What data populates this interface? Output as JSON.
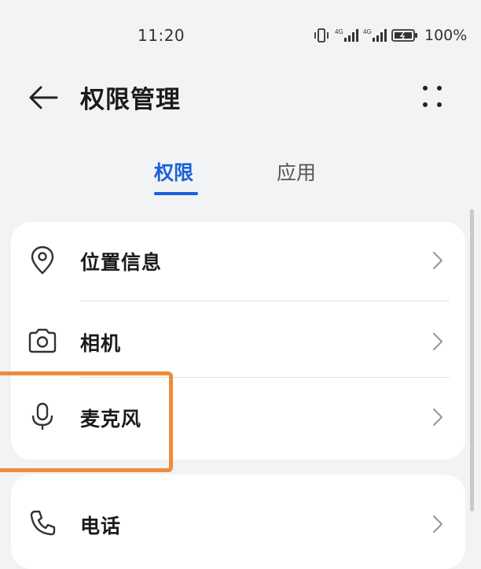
{
  "status_bar": {
    "time": "11:20",
    "battery_percent": "100%",
    "network_badge_1": "4G",
    "network_badge_2": "4G"
  },
  "header": {
    "title": "权限管理"
  },
  "tabs": [
    {
      "label": "权限",
      "active": true
    },
    {
      "label": "应用",
      "active": false
    }
  ],
  "permissions": [
    {
      "label": "位置信息",
      "icon": "location-pin-icon"
    },
    {
      "label": "相机",
      "icon": "camera-icon"
    },
    {
      "label": "麦克风",
      "icon": "microphone-icon"
    }
  ],
  "next_card": {
    "label": "电话",
    "icon": "phone-icon"
  },
  "colors": {
    "accent": "#1c5fd9",
    "highlight": "#f08b3a",
    "background": "#f1f3f5",
    "card": "#ffffff"
  }
}
